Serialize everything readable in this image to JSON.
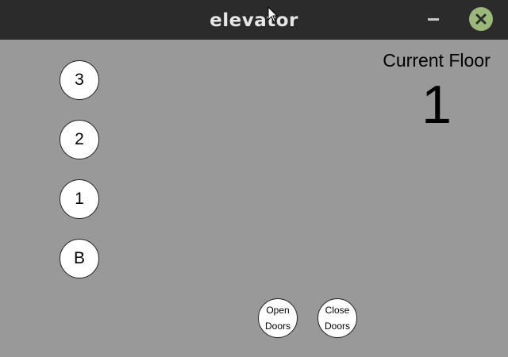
{
  "window": {
    "title": "elevator"
  },
  "floor_buttons": [
    {
      "label": "3"
    },
    {
      "label": "2"
    },
    {
      "label": "1"
    },
    {
      "label": "B"
    }
  ],
  "status": {
    "label": "Current Floor",
    "value": "1"
  },
  "doors": {
    "open": {
      "line1": "Open",
      "line2": "Doors"
    },
    "close": {
      "line1": "Close",
      "line2": "Doors"
    }
  },
  "colors": {
    "titlebar": "#2b2b2b",
    "background": "#999999",
    "close_button": "#9ab87a",
    "button_fill": "#ffffff"
  },
  "icons": {
    "minimize": "minimize-icon",
    "close": "close-icon",
    "cursor": "mouse-cursor-icon"
  }
}
